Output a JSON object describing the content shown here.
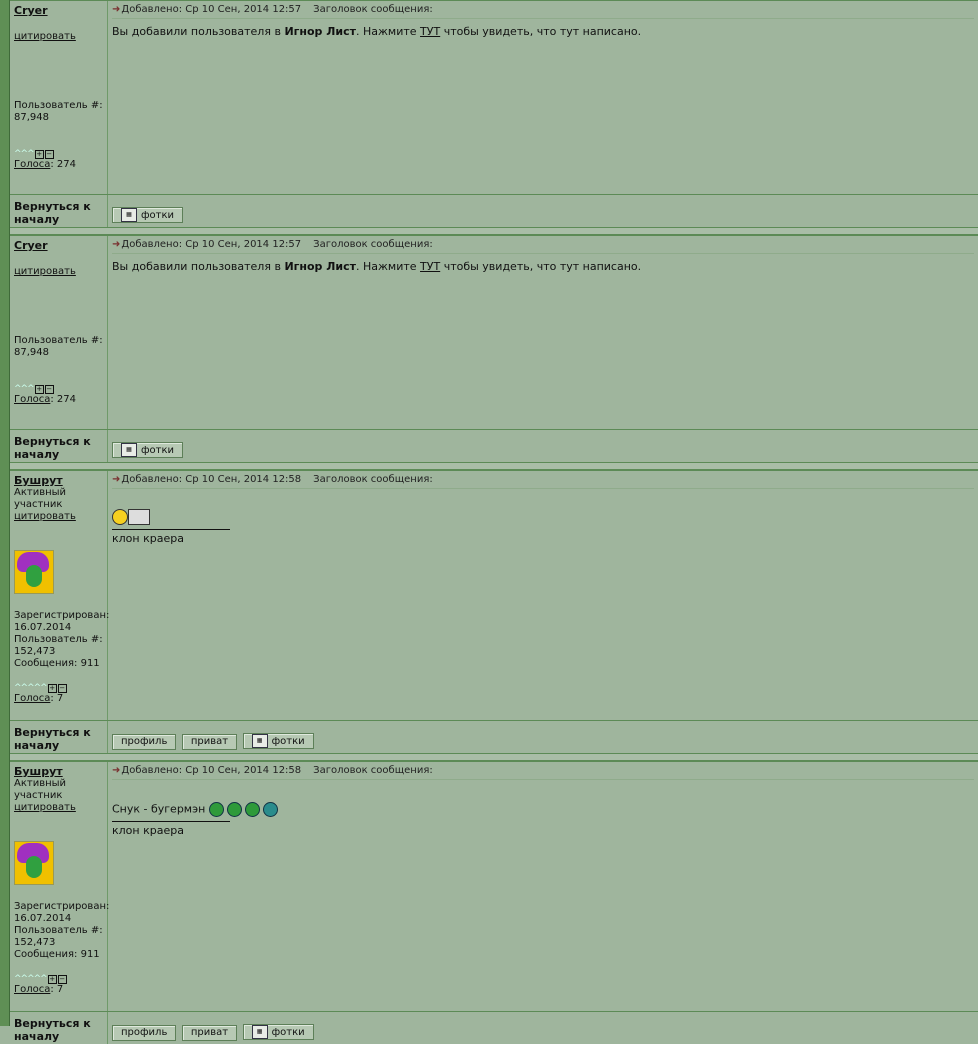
{
  "posts": [
    {
      "username": "Cryer",
      "quote": "цитировать",
      "rank": "",
      "user_number_label": "Пользователь #:",
      "user_number": "87,948",
      "votes_label": "Голоса",
      "votes": ": 274",
      "header_added": "Добавлено: Ср 10 Сен, 2014 12:57",
      "header_subject": "Заголовок сообщения:",
      "msg_prefix": "Вы добавили пользователя в ",
      "msg_bold": "Игнор Лист",
      "msg_mid": ". Нажмите ",
      "msg_link": "ТУТ",
      "msg_suffix": " чтобы увидеть, что тут написано.",
      "back_to_top": "Вернуться к началу",
      "buttons": [
        "фотки"
      ]
    },
    {
      "username": "Cryer",
      "quote": "цитировать",
      "user_number_label": "Пользователь #:",
      "user_number": "87,948",
      "votes_label": "Голоса",
      "votes": ": 274",
      "header_added": "Добавлено: Ср 10 Сен, 2014 12:57",
      "header_subject": "Заголовок сообщения:",
      "msg_prefix": "Вы добавили пользователя в ",
      "msg_bold": "Игнор Лист",
      "msg_mid": ". Нажмите ",
      "msg_link": "ТУТ",
      "msg_suffix": " чтобы увидеть, что тут написано.",
      "back_to_top": "Вернуться к началу",
      "buttons": [
        "фотки"
      ]
    },
    {
      "username": "Бушрут",
      "rank": "Активный участник",
      "quote": "цитировать",
      "registered_label": "Зарегистрирован:",
      "registered": "16.07.2014",
      "user_number_label": "Пользователь #:",
      "user_number": "152,473",
      "messages_label": "Сообщения:",
      "messages": "911",
      "votes_label": "Голоса",
      "votes": ": 7",
      "header_added": "Добавлено: Ср 10 Сен, 2014 12:58",
      "header_subject": "Заголовок сообщения:",
      "signature": "клон краера",
      "back_to_top": "Вернуться к началу",
      "buttons": [
        "профиль",
        "приват",
        "фотки"
      ]
    },
    {
      "username": "Бушрут",
      "rank": "Активный участник",
      "quote": "цитировать",
      "registered_label": "Зарегистрирован:",
      "registered": "16.07.2014",
      "user_number_label": "Пользователь #:",
      "user_number": "152,473",
      "messages_label": "Сообщения:",
      "messages": "911",
      "votes_label": "Голоса",
      "votes": ": 7",
      "header_added": "Добавлено: Ср 10 Сен, 2014 12:58",
      "header_subject": "Заголовок сообщения:",
      "msg_text": "Снук - бугермэн",
      "signature": "клон краера",
      "back_to_top": "Вернуться к началу",
      "buttons": [
        "профиль",
        "приват",
        "фотки"
      ]
    }
  ]
}
